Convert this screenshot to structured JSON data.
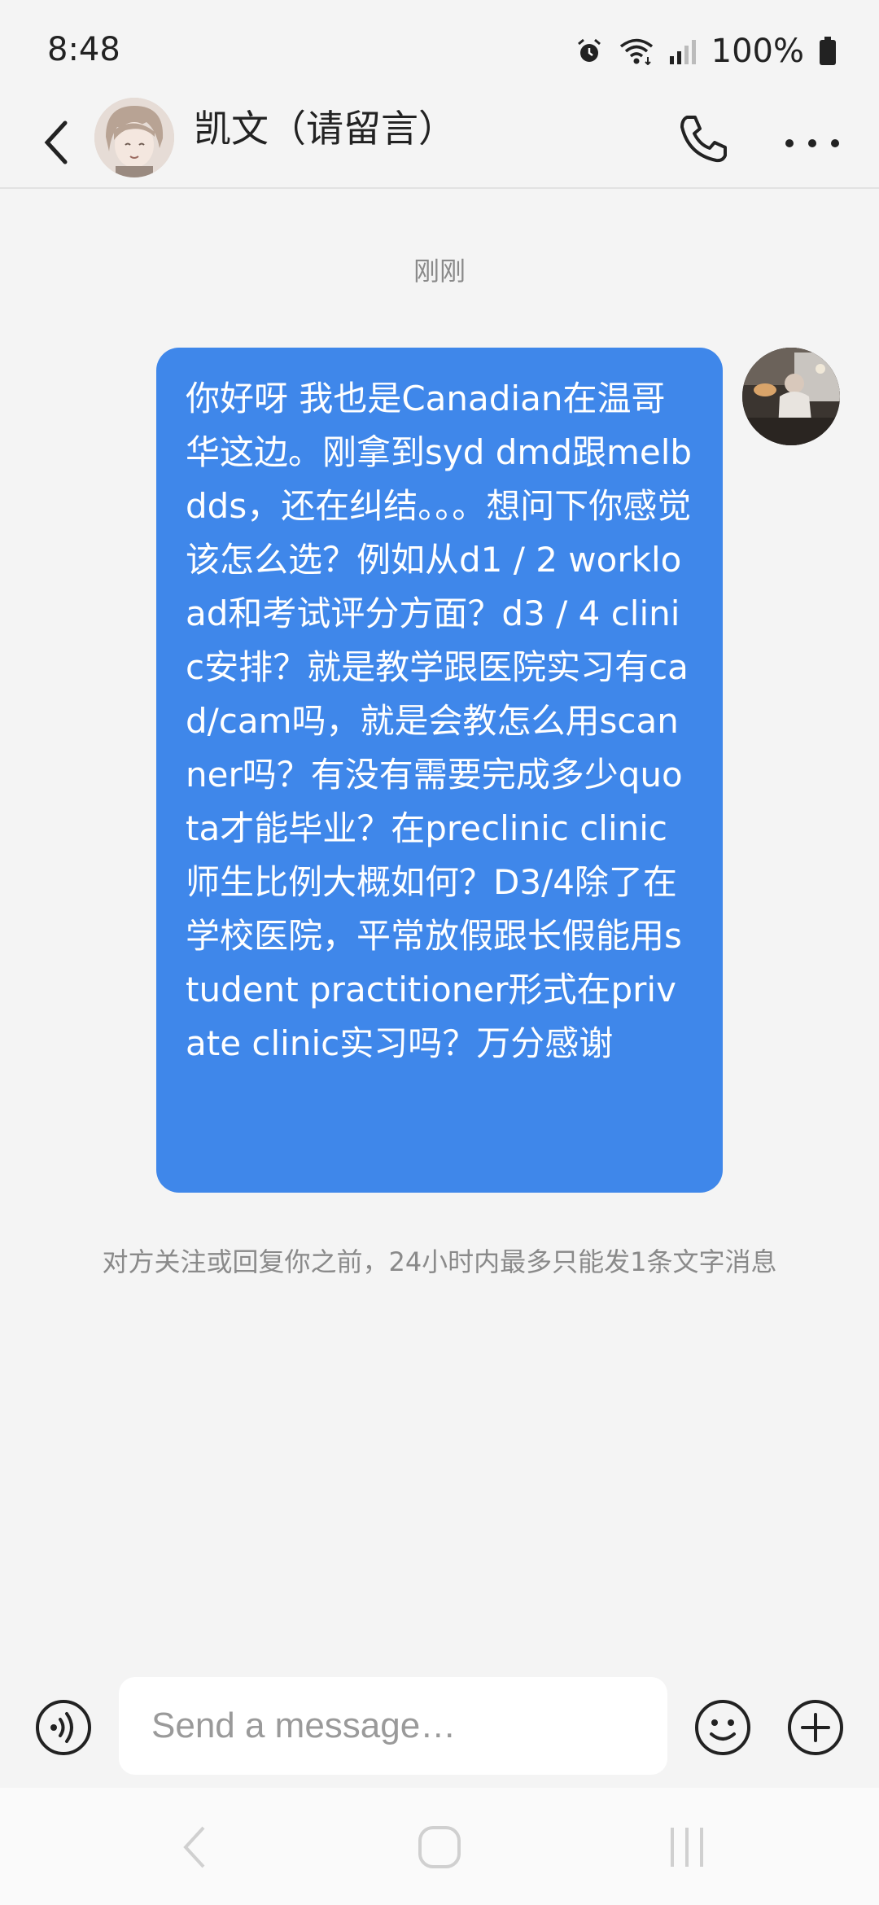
{
  "status_bar": {
    "time": "8:48",
    "battery": "100%",
    "icons": [
      "alarm-icon",
      "wifi-icon",
      "signal-icon",
      "battery-icon"
    ]
  },
  "header": {
    "contact_name": "凯文（请留言）",
    "icons": [
      "back-icon",
      "phone-icon",
      "more-icon"
    ]
  },
  "chat": {
    "timestamp": "刚刚",
    "message": "你好呀 我也是Canadian在温哥华这边。刚拿到syd dmd跟melb dds，还在纠结。。。想问下你感觉该怎么选？例如从d1 / 2 workload和考试评分方面？d3 / 4 clinic安排？就是教学跟医院实习有cad/cam吗，就是会教怎么用scanner吗？有没有需要完成多少quota才能毕业？在preclinic clinic师生比例大概如何？D3/4除了在学校医院，平常放假跟长假能用student practitioner形式在private clinic实习吗？万分感谢",
    "limit_note": "对方关注或回复你之前，24小时内最多只能发1条文字消息"
  },
  "input_bar": {
    "placeholder": "Send a message…",
    "icons": [
      "voice-icon",
      "emoji-icon",
      "plus-icon"
    ]
  },
  "nav_bar": {
    "icons": [
      "nav-back-icon",
      "nav-home-icon",
      "nav-recents-icon"
    ]
  },
  "colors": {
    "bubble": "#3f87ea",
    "background": "#f4f4f4",
    "muted_text": "#8a8a8a"
  }
}
